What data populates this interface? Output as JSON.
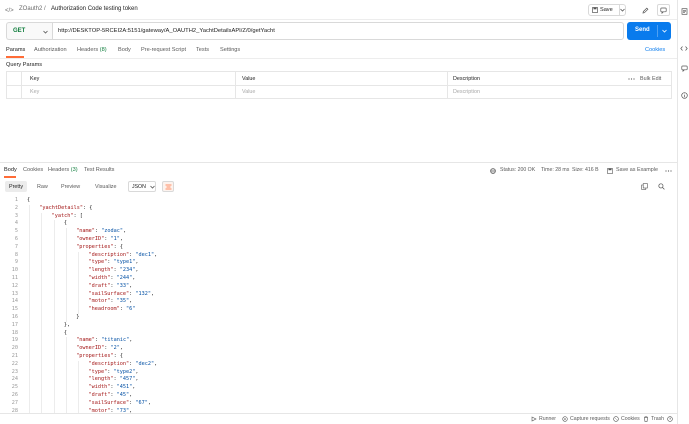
{
  "header": {
    "collection": "ZOauth2",
    "separator": "/",
    "request_name": "Authorization Code testing token",
    "save_label": "Save"
  },
  "request": {
    "method": "GET",
    "url": "http://DESKTOP-5RCEI2A:5151/gateway/A_OAUTH2_YachtDetailsAPI/Z/0/getYacht",
    "send_label": "Send",
    "cookies_label": "Cookies"
  },
  "request_tabs": [
    {
      "label": "Params",
      "active": true
    },
    {
      "label": "Authorization",
      "active": false
    },
    {
      "label": "Headers",
      "count": "(8)",
      "active": false
    },
    {
      "label": "Body",
      "active": false
    },
    {
      "label": "Pre-request Script",
      "active": false
    },
    {
      "label": "Tests",
      "active": false
    },
    {
      "label": "Settings",
      "active": false
    }
  ],
  "params": {
    "section_label": "Query Params",
    "headers": {
      "key": "Key",
      "value": "Value",
      "description": "Description"
    },
    "bulk_edit": "Bulk Edit",
    "placeholders": {
      "key": "Key",
      "value": "Value",
      "description": "Description"
    }
  },
  "response": {
    "tabs": [
      {
        "label": "Body",
        "active": true
      },
      {
        "label": "Cookies",
        "active": false
      },
      {
        "label": "Headers",
        "count": "(3)",
        "active": false
      },
      {
        "label": "Test Results",
        "active": false
      }
    ],
    "status": "Status: 200 OK",
    "time": "Time: 28 ms",
    "size": "Size: 416 B",
    "save_example": "Save as Example",
    "views": [
      "Pretty",
      "Raw",
      "Preview",
      "Visualize"
    ],
    "format": "JSON",
    "lines": [
      {
        "n": "1",
        "indent": 0,
        "parts": [
          [
            "p",
            "{"
          ]
        ]
      },
      {
        "n": "2",
        "indent": 1,
        "parts": [
          [
            "k",
            "\"yachtDetails\""
          ],
          [
            "p",
            ": {"
          ]
        ]
      },
      {
        "n": "3",
        "indent": 2,
        "parts": [
          [
            "k",
            "\"yatch\""
          ],
          [
            "p",
            ": ["
          ]
        ]
      },
      {
        "n": "4",
        "indent": 3,
        "parts": [
          [
            "p",
            "{"
          ]
        ]
      },
      {
        "n": "5",
        "indent": 4,
        "parts": [
          [
            "k",
            "\"name\""
          ],
          [
            "p",
            ": "
          ],
          [
            "s",
            "\"zodac\""
          ],
          [
            "p",
            ","
          ]
        ]
      },
      {
        "n": "6",
        "indent": 4,
        "parts": [
          [
            "k",
            "\"ownerID\""
          ],
          [
            "p",
            ": "
          ],
          [
            "s",
            "\"1\""
          ],
          [
            "p",
            ","
          ]
        ]
      },
      {
        "n": "7",
        "indent": 4,
        "parts": [
          [
            "k",
            "\"properties\""
          ],
          [
            "p",
            ": {"
          ]
        ]
      },
      {
        "n": "8",
        "indent": 5,
        "parts": [
          [
            "k",
            "\"description\""
          ],
          [
            "p",
            ": "
          ],
          [
            "s",
            "\"dec1\""
          ],
          [
            "p",
            ","
          ]
        ]
      },
      {
        "n": "9",
        "indent": 5,
        "parts": [
          [
            "k",
            "\"type\""
          ],
          [
            "p",
            ": "
          ],
          [
            "s",
            "\"type1\""
          ],
          [
            "p",
            ","
          ]
        ]
      },
      {
        "n": "10",
        "indent": 5,
        "parts": [
          [
            "k",
            "\"length\""
          ],
          [
            "p",
            ": "
          ],
          [
            "s",
            "\"234\""
          ],
          [
            "p",
            ","
          ]
        ]
      },
      {
        "n": "11",
        "indent": 5,
        "parts": [
          [
            "k",
            "\"width\""
          ],
          [
            "p",
            ": "
          ],
          [
            "s",
            "\"244\""
          ],
          [
            "p",
            ","
          ]
        ]
      },
      {
        "n": "12",
        "indent": 5,
        "parts": [
          [
            "k",
            "\"draft\""
          ],
          [
            "p",
            ": "
          ],
          [
            "s",
            "\"33\""
          ],
          [
            "p",
            ","
          ]
        ]
      },
      {
        "n": "13",
        "indent": 5,
        "parts": [
          [
            "k",
            "\"sailSurface\""
          ],
          [
            "p",
            ": "
          ],
          [
            "s",
            "\"132\""
          ],
          [
            "p",
            ","
          ]
        ]
      },
      {
        "n": "14",
        "indent": 5,
        "parts": [
          [
            "k",
            "\"motor\""
          ],
          [
            "p",
            ": "
          ],
          [
            "s",
            "\"35\""
          ],
          [
            "p",
            ","
          ]
        ]
      },
      {
        "n": "15",
        "indent": 5,
        "parts": [
          [
            "k",
            "\"headroom\""
          ],
          [
            "p",
            ": "
          ],
          [
            "s",
            "\"6\""
          ]
        ]
      },
      {
        "n": "16",
        "indent": 4,
        "parts": [
          [
            "p",
            "}"
          ]
        ]
      },
      {
        "n": "17",
        "indent": 3,
        "parts": [
          [
            "p",
            "},"
          ]
        ]
      },
      {
        "n": "18",
        "indent": 3,
        "parts": [
          [
            "p",
            "{"
          ]
        ]
      },
      {
        "n": "19",
        "indent": 4,
        "parts": [
          [
            "k",
            "\"name\""
          ],
          [
            "p",
            ": "
          ],
          [
            "s",
            "\"titanic\""
          ],
          [
            "p",
            ","
          ]
        ]
      },
      {
        "n": "20",
        "indent": 4,
        "parts": [
          [
            "k",
            "\"ownerID\""
          ],
          [
            "p",
            ": "
          ],
          [
            "s",
            "\"2\""
          ],
          [
            "p",
            ","
          ]
        ]
      },
      {
        "n": "21",
        "indent": 4,
        "parts": [
          [
            "k",
            "\"properties\""
          ],
          [
            "p",
            ": {"
          ]
        ]
      },
      {
        "n": "22",
        "indent": 5,
        "parts": [
          [
            "k",
            "\"description\""
          ],
          [
            "p",
            ": "
          ],
          [
            "s",
            "\"dec2\""
          ],
          [
            "p",
            ","
          ]
        ]
      },
      {
        "n": "23",
        "indent": 5,
        "parts": [
          [
            "k",
            "\"type\""
          ],
          [
            "p",
            ": "
          ],
          [
            "s",
            "\"type2\""
          ],
          [
            "p",
            ","
          ]
        ]
      },
      {
        "n": "24",
        "indent": 5,
        "parts": [
          [
            "k",
            "\"length\""
          ],
          [
            "p",
            ": "
          ],
          [
            "s",
            "\"457\""
          ],
          [
            "p",
            ","
          ]
        ]
      },
      {
        "n": "25",
        "indent": 5,
        "parts": [
          [
            "k",
            "\"width\""
          ],
          [
            "p",
            ": "
          ],
          [
            "s",
            "\"451\""
          ],
          [
            "p",
            ","
          ]
        ]
      },
      {
        "n": "26",
        "indent": 5,
        "parts": [
          [
            "k",
            "\"draft\""
          ],
          [
            "p",
            ": "
          ],
          [
            "s",
            "\"45\""
          ],
          [
            "p",
            ","
          ]
        ]
      },
      {
        "n": "27",
        "indent": 5,
        "parts": [
          [
            "k",
            "\"sailSurface\""
          ],
          [
            "p",
            ": "
          ],
          [
            "s",
            "\"67\""
          ],
          [
            "p",
            ","
          ]
        ]
      },
      {
        "n": "28",
        "indent": 5,
        "parts": [
          [
            "k",
            "\"motor\""
          ],
          [
            "p",
            ": "
          ],
          [
            "s",
            "\"73\""
          ],
          [
            "p",
            ","
          ]
        ]
      }
    ]
  },
  "footer": {
    "runner": "Runner",
    "capture": "Capture requests",
    "cookies": "Cookies",
    "trash": "Trash"
  },
  "colors": {
    "accent": "#ff6c37",
    "send": "#097bed",
    "status_ok": "#1a8a3a"
  }
}
